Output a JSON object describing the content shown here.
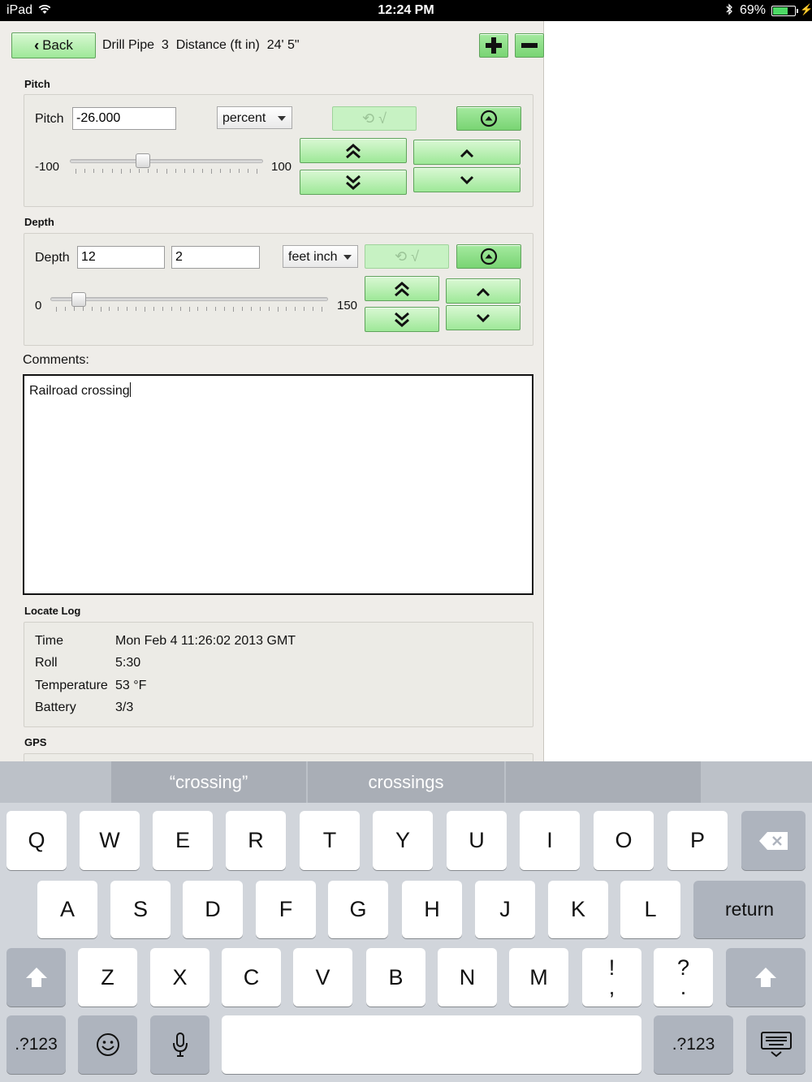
{
  "status_bar": {
    "carrier": "iPad",
    "time": "12:24 PM",
    "battery_percent": "69%",
    "battery_level": 0.69
  },
  "header": {
    "back_label": "Back",
    "title": "Drill Pipe  3  Distance (ft in)  24' 5\"",
    "add_icon": "plus-icon",
    "remove_icon": "minus-icon"
  },
  "pitch": {
    "section_title": "Pitch",
    "field_label": "Pitch",
    "value": "-26.000",
    "unit": "percent",
    "slider_min": "-100",
    "slider_max": "100",
    "slider_value": -26
  },
  "depth": {
    "section_title": "Depth",
    "field_label": "Depth",
    "feet": "12",
    "inches": "2",
    "unit": "feet inch",
    "slider_min": "0",
    "slider_max": "150",
    "slider_value": 12.2
  },
  "comments": {
    "label": "Comments:",
    "value": "Railroad crossing"
  },
  "locate_log": {
    "section_title": "Locate Log",
    "rows": [
      {
        "label": "Time",
        "value": "Mon Feb 4 11:26:02 2013 GMT"
      },
      {
        "label": "Roll",
        "value": "5:30"
      },
      {
        "label": "Temperature",
        "value": "53 °F"
      },
      {
        "label": "Battery",
        "value": "3/3"
      }
    ]
  },
  "gps": {
    "section_title": "GPS"
  },
  "keyboard": {
    "suggestions": [
      "“crossing”",
      "crossings",
      ""
    ],
    "row1": [
      "Q",
      "W",
      "E",
      "R",
      "T",
      "Y",
      "U",
      "I",
      "O",
      "P"
    ],
    "row2": [
      "A",
      "S",
      "D",
      "F",
      "G",
      "H",
      "J",
      "K",
      "L"
    ],
    "row3": [
      "Z",
      "X",
      "C",
      "V",
      "B",
      "N",
      "M"
    ],
    "return_label": "return",
    "numbers_label": ".?123",
    "exclaim_top": "!",
    "exclaim_bottom": ",",
    "question_top": "?",
    "question_bottom": "."
  },
  "colors": {
    "button_green": "#9ee898",
    "panel_bg": "#efede9",
    "keyboard_bg": "#d1d5db"
  }
}
